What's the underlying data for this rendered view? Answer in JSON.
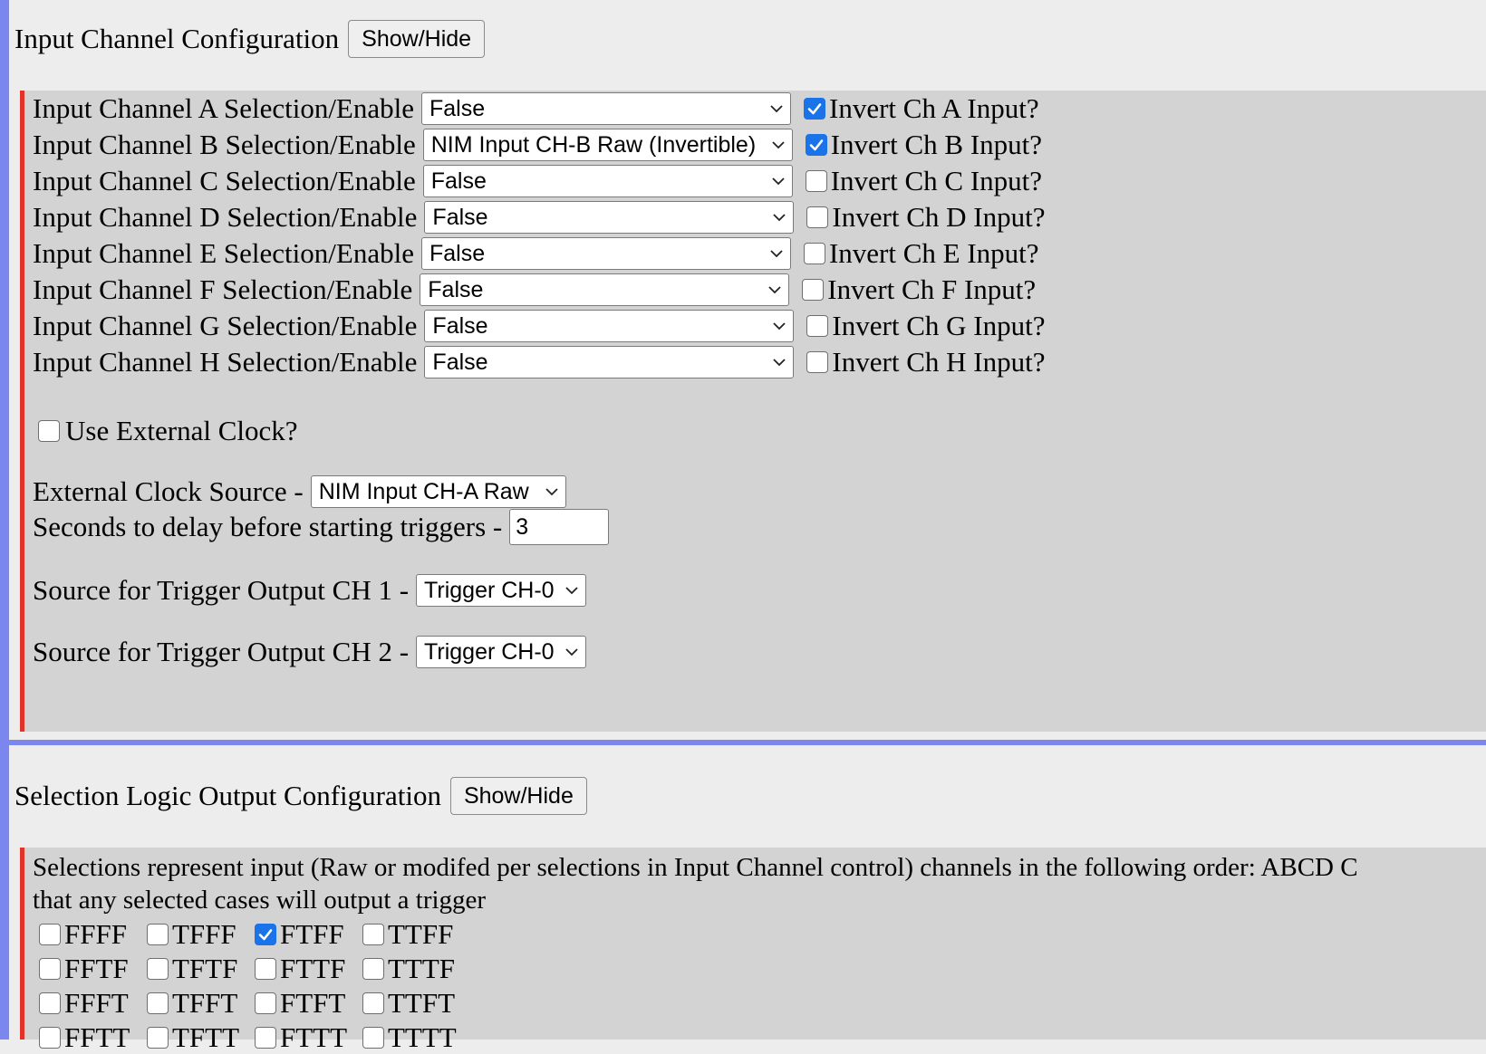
{
  "section1": {
    "title": "Input Channel Configuration",
    "toggle_label": "Show/Hide",
    "channels": [
      {
        "label": "Input Channel A Selection/Enable",
        "value": "False",
        "invert_label": "Invert Ch A Input?",
        "inverted": true
      },
      {
        "label": "Input Channel B Selection/Enable",
        "value": "NIM Input CH-B Raw (Invertible)",
        "invert_label": "Invert Ch B Input?",
        "inverted": true
      },
      {
        "label": "Input Channel C Selection/Enable",
        "value": "False",
        "invert_label": "Invert Ch C Input?",
        "inverted": false
      },
      {
        "label": "Input Channel D Selection/Enable",
        "value": "False",
        "invert_label": "Invert Ch D Input?",
        "inverted": false
      },
      {
        "label": "Input Channel E Selection/Enable",
        "value": "False",
        "invert_label": "Invert Ch E Input?",
        "inverted": false
      },
      {
        "label": "Input Channel F Selection/Enable",
        "value": "False",
        "invert_label": "Invert Ch F Input?",
        "inverted": false
      },
      {
        "label": "Input Channel G Selection/Enable",
        "value": "False",
        "invert_label": "Invert Ch G Input?",
        "inverted": false
      },
      {
        "label": "Input Channel H Selection/Enable",
        "value": "False",
        "invert_label": "Invert Ch H Input?",
        "inverted": false
      }
    ],
    "external_clock_label": "Use External Clock?",
    "external_clock_checked": false,
    "clock_source_label": "External Clock Source -",
    "clock_source_value": "NIM Input CH-A Raw",
    "delay_label": "Seconds to delay before starting triggers -",
    "delay_value": "3",
    "trigger_out1_label": "Source for Trigger Output CH 1 -",
    "trigger_out1_value": "Trigger CH-0",
    "trigger_out2_label": "Source for Trigger Output CH 2 -",
    "trigger_out2_value": "Trigger CH-0"
  },
  "section2": {
    "title": "Selection Logic Output Configuration",
    "toggle_label": "Show/Hide",
    "description_line1": "Selections represent input (Raw or modifed per selections in Input Channel control) channels in the following order: ABCD C",
    "description_line2": "that any selected cases will output a trigger",
    "grid": [
      [
        {
          "label": "FFFF",
          "checked": false
        },
        {
          "label": "TFFF",
          "checked": false
        },
        {
          "label": "FTFF",
          "checked": true
        },
        {
          "label": "TTFF",
          "checked": false
        }
      ],
      [
        {
          "label": "FFTF",
          "checked": false
        },
        {
          "label": "TFTF",
          "checked": false
        },
        {
          "label": "FTTF",
          "checked": false
        },
        {
          "label": "TTTF",
          "checked": false
        }
      ],
      [
        {
          "label": "FFFT",
          "checked": false
        },
        {
          "label": "TFFT",
          "checked": false
        },
        {
          "label": "FTFT",
          "checked": false
        },
        {
          "label": "TTFT",
          "checked": false
        }
      ],
      [
        {
          "label": "FFTT",
          "checked": false
        },
        {
          "label": "TFTT",
          "checked": false
        },
        {
          "label": "FTTT",
          "checked": false
        },
        {
          "label": "TTTT",
          "checked": false
        }
      ]
    ]
  },
  "colors": {
    "accent_blue": "#7b87ee",
    "panel_border_red": "#e0342a",
    "checkbox_checked": "#1a73e8"
  },
  "icons": {
    "select_arrow": "chevron-down-icon",
    "checkmark": "checkmark-icon"
  }
}
